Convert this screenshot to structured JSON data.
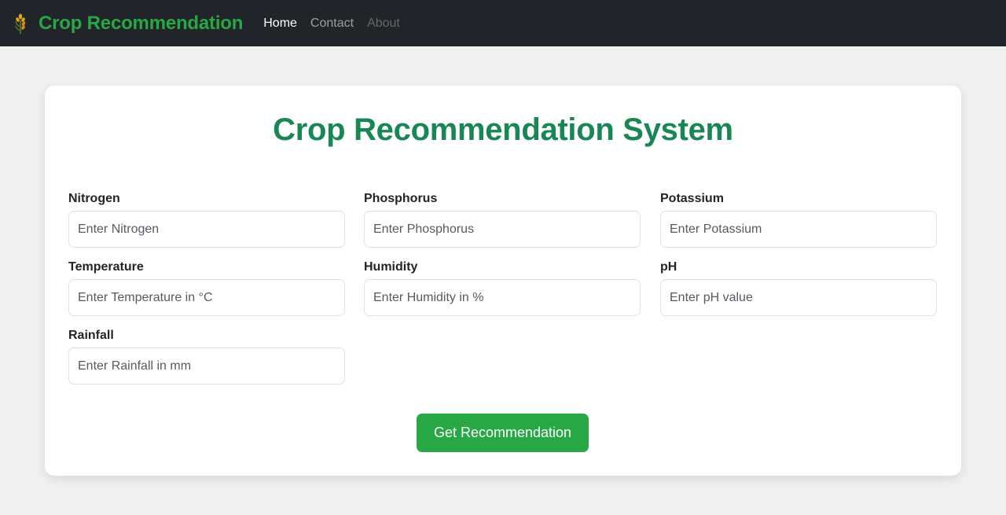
{
  "navbar": {
    "brand": "Crop Recommendation",
    "brand_icon": "wheat-icon",
    "links": [
      {
        "label": "Home",
        "state": "active"
      },
      {
        "label": "Contact",
        "state": "normal"
      },
      {
        "label": "About",
        "state": "muted"
      }
    ]
  },
  "form": {
    "title": "Crop Recommendation System",
    "fields": {
      "nitrogen": {
        "label": "Nitrogen",
        "placeholder": "Enter Nitrogen",
        "value": ""
      },
      "phosphorus": {
        "label": "Phosphorus",
        "placeholder": "Enter Phosphorus",
        "value": ""
      },
      "potassium": {
        "label": "Potassium",
        "placeholder": "Enter Potassium",
        "value": ""
      },
      "temperature": {
        "label": "Temperature",
        "placeholder": "Enter Temperature in °C",
        "value": ""
      },
      "humidity": {
        "label": "Humidity",
        "placeholder": "Enter Humidity in %",
        "value": ""
      },
      "ph": {
        "label": "pH",
        "placeholder": "Enter pH value",
        "value": ""
      },
      "rainfall": {
        "label": "Rainfall",
        "placeholder": "Enter Rainfall in mm",
        "value": ""
      }
    },
    "submit_label": "Get Recommendation"
  },
  "colors": {
    "navbar_bg": "#212529",
    "brand": "#28a745",
    "title": "#198754",
    "button": "#28a745",
    "page_bg": "#f0f0f0"
  }
}
